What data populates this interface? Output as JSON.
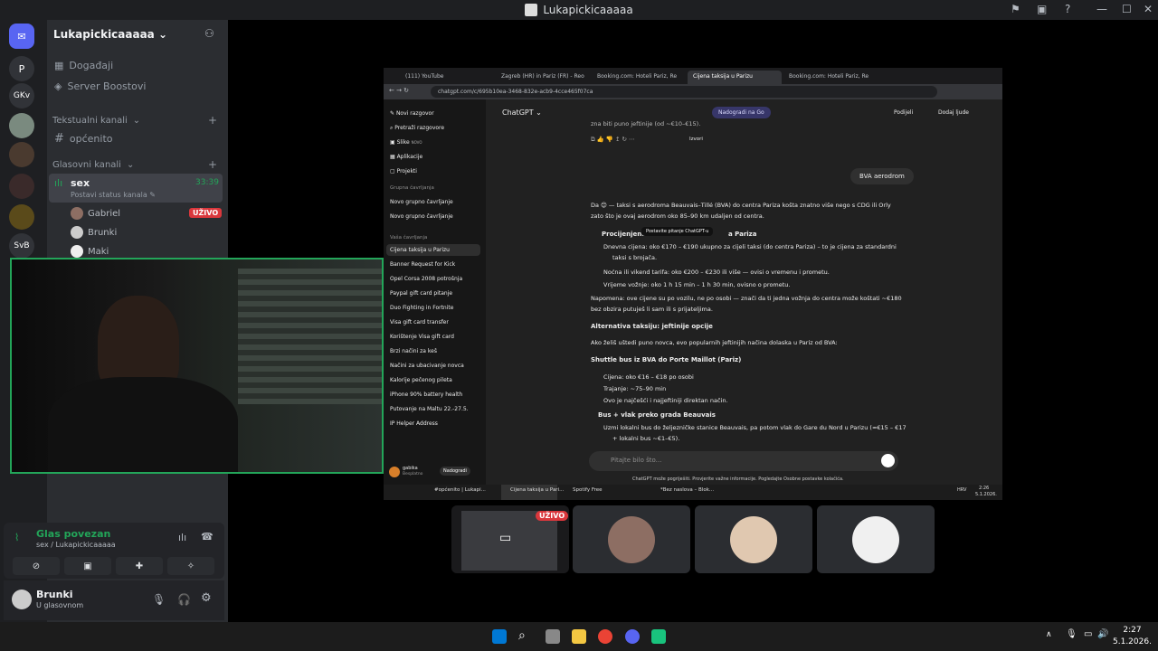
{
  "window": {
    "title": "Lukapickicaaaaa"
  },
  "rail": {
    "servers": [
      "P",
      "GKv",
      "SvB"
    ]
  },
  "sidebar": {
    "guild_name": "Lukapickicaaaaa",
    "events": "Događaji",
    "boosts": "Server Boostovi",
    "text_category": "Tekstualni kanali",
    "text_channel": "općenito",
    "voice_category": "Glasovni kanali",
    "voice_channel": "sex",
    "voice_timer": "33:39",
    "voice_status": "Postavi status kanala",
    "voice_users": [
      "Gabriel",
      "Brunki",
      "Maki"
    ],
    "live_badge": "UŽIVO"
  },
  "voice_panel": {
    "title": "Glas povezan",
    "subtitle": "sex / Lukapickicaaaaa"
  },
  "user_panel": {
    "name": "Brunki",
    "status": "U glasovnom"
  },
  "share": {
    "tabs": [
      "(111) YouTube",
      "Zagreb (HR) in Pariz (FR) - Reo",
      "Booking.com: Hoteli Pariz, Re",
      "Cijena taksija u Parizu",
      "Booking.com: Hoteli Pariz, Re"
    ],
    "url": "chatgpt.com/c/695b10ea-3468-832e-acb9-4cce465f07ca",
    "gpt_sidebar": {
      "top_items": [
        "Novi razgovor",
        "Pretraži razgovore",
        "Slike",
        "Aplikacije",
        "Projekti"
      ],
      "slike_badge": "NOVO",
      "group_section": "Grupna čavrljanja",
      "group_items": [
        "Novo grupno čavrljanje",
        "Novo grupno čavrljanje"
      ],
      "chats_section": "Vaša čavrljanja",
      "chats": [
        "Cijena taksija u Parizu",
        "Banner Request for Kick",
        "Opel Corsa 2008 potrošnja",
        "Paypal gift card pitanje",
        "Duo Fighting in Fortnite",
        "Visa gift card transfer",
        "Korištenje Visa gift card",
        "Brzi načini za keš",
        "Načini za ubacivanje novca",
        "Kalorije pečenog pileta",
        "iPhone 90% battery health",
        "Putovanje na Maltu 22.-27.5.",
        "IP Helper Address"
      ],
      "user_name": "gabika",
      "user_plan": "Besplatno",
      "upgrade": "Nadogradi"
    },
    "gpt_main": {
      "model": "ChatGPT",
      "upgrade_pill": "Nadogradi na Go",
      "share_btn": "Podijeli",
      "add_people": "Dodaj ljude",
      "prev_tail": "zna biti puno jeftinije (od ~€10–€15).",
      "sources_label": "Izvori",
      "user_msg": "BVA aerodrom",
      "intro_1": "Da 😊 — taksi s aerodroma Beauvais–Tillé (BVA) do centra Pariza košta znatno više nego s CDG ili Orly",
      "intro_2": "zato što je ovaj aerodrom oko 85–90 km udaljen od centra.",
      "section1_a": "Procijenjena",
      "tooltip": "Postavite pitanje ChatGPT-u",
      "section1_b": "a Pariza",
      "b1": "Dnevna cijena: oko €170 – €190 ukupno za cijeli taksi (do centra Pariza) – to je cijena za standardni",
      "b1b": "taksi s brojača.",
      "b2": "Noćna ili vikend tarifa: oko €200 – €230 ili više — ovisi o vremenu i prometu.",
      "b3": "Vrijeme vožnje: oko 1 h 15 min – 1 h 30 min, ovisno o prometu.",
      "note_1": "Napomena: ove cijene su po vozilu, ne po osobi — znači da ti jedna vožnja do centra može koštati ~€180",
      "note_2": "bez obzira putuješ li sam ili s prijateljima.",
      "alt_title": "Alternativa taksiju: jeftinije opcije",
      "alt_intro": "Ako želiš uštedi puno novca, evo popularnih jeftinijih načina dolaska u Pariz od BVA:",
      "shuttle_title": "Shuttle bus iz BVA do Porte Maillot (Pariz)",
      "s1": "Cijena: oko €16 – €18 po osobi",
      "s2": "Trajanje: ~75–90 min",
      "s3": "Ovo je najčešći i najjeftiniji direktan način.",
      "bus_title": "Bus + vlak preko grada Beauvais",
      "t1": "Uzmi lokalni bus do željezničke stanice Beauvais, pa potom vlak do Gare du Nord u Parizu (≈€15 – €17",
      "t2": "+ lokalni bus ~€1–€5).",
      "input_placeholder": "Pitajte bilo što...",
      "disclaimer": "ChatGPT može pogriješiti. Provjerite važne informacije. Pogledajte Osobne postavke kolačića."
    },
    "taskbar_items": [
      "#općenito | Lukapi...",
      "Cijena taksija u Pari...",
      "Spotify Free",
      "*Bez naslova – Blok..."
    ],
    "taskbar_tray": {
      "lang": "HRV",
      "time": "2:26",
      "date": "5.1.2026."
    }
  },
  "stream_badge": "UŽIVO",
  "os_clock": {
    "time": "2:27",
    "date": "5.1.2026."
  }
}
